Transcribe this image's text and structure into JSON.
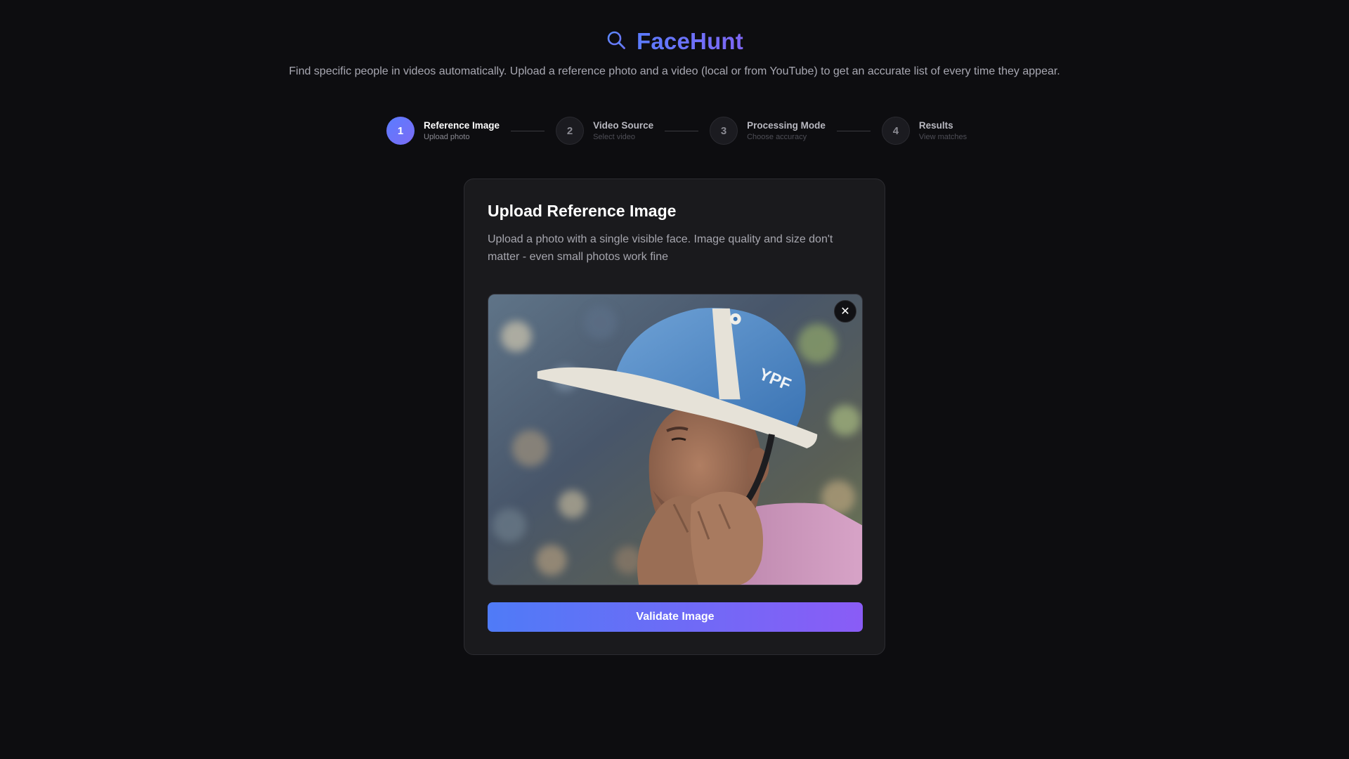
{
  "header": {
    "icon": "search-icon",
    "title": "FaceHunt",
    "tagline": "Find specific people in videos automatically. Upload a reference photo and a video (local or from YouTube) to get an accurate list of every time they appear."
  },
  "steps": [
    {
      "number": "1",
      "label": "Reference Image",
      "sub": "Upload photo",
      "active": true
    },
    {
      "number": "2",
      "label": "Video Source",
      "sub": "Select video",
      "active": false
    },
    {
      "number": "3",
      "label": "Processing Mode",
      "sub": "Choose accuracy",
      "active": false
    },
    {
      "number": "4",
      "label": "Results",
      "sub": "View matches",
      "active": false
    }
  ],
  "card": {
    "title": "Upload Reference Image",
    "description": "Upload a photo with a single visible face. Image quality and size don't matter - even small photos work fine",
    "helmet_text": "YPF",
    "remove_icon": "close-icon",
    "remove_glyph": "✕",
    "validate_label": "Validate Image"
  },
  "colors": {
    "accent_start": "#5b7cff",
    "accent_end": "#8a5cf6",
    "background": "#0d0d10",
    "card": "#1a1a1d"
  }
}
